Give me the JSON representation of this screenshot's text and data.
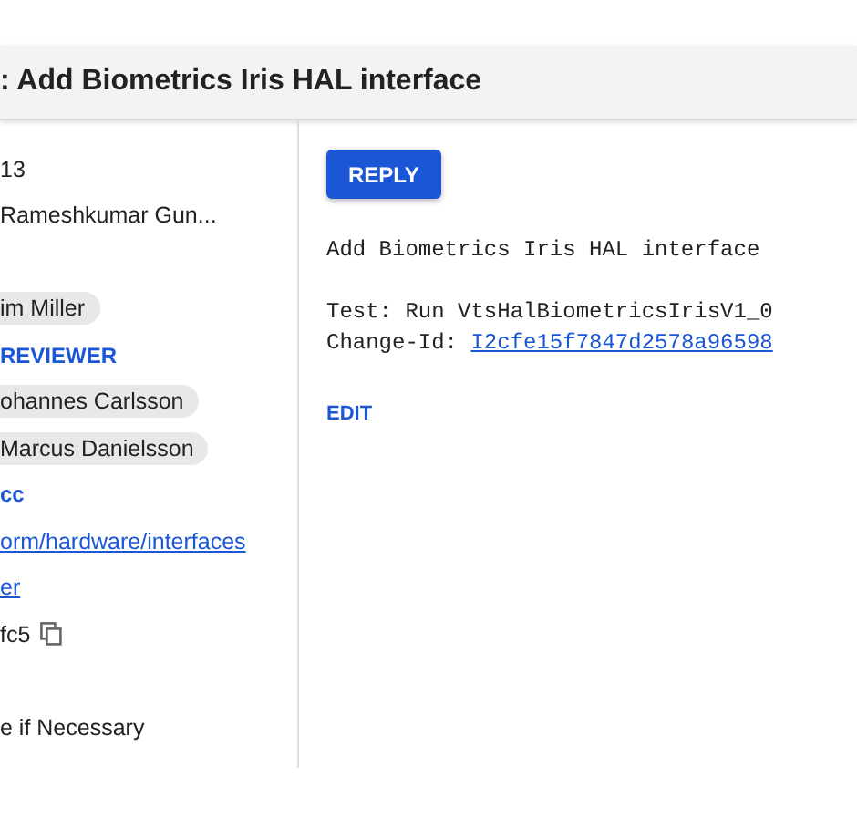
{
  "header": {
    "title": ": Add Biometrics Iris HAL interface"
  },
  "sidebar": {
    "items": [
      {
        "kind": "text",
        "text": "13"
      },
      {
        "kind": "text",
        "text": "Rameshkumar Gun..."
      },
      {
        "kind": "gap"
      },
      {
        "kind": "chip",
        "text": "im Miller"
      },
      {
        "kind": "action",
        "text": "REVIEWER"
      },
      {
        "kind": "chip",
        "text": "ohannes Carlsson"
      },
      {
        "kind": "chip",
        "text": "Marcus Danielsson"
      },
      {
        "kind": "action",
        "text": "cc"
      },
      {
        "kind": "link",
        "text": "orm/hardware/interfaces"
      },
      {
        "kind": "link",
        "text": "er"
      },
      {
        "kind": "copy",
        "text": "fc5"
      },
      {
        "kind": "gap"
      },
      {
        "kind": "text",
        "text": "e if Necessary"
      }
    ]
  },
  "main": {
    "reply_button": "REPLY",
    "subject": "Add Biometrics Iris HAL interface",
    "body": [
      "Test: Run VtsHalBiometricsIrisV1_0"
    ],
    "change_id_label": "Change-Id: ",
    "change_id": "I2cfe15f7847d2578a96598",
    "edit_button": "EDIT"
  }
}
